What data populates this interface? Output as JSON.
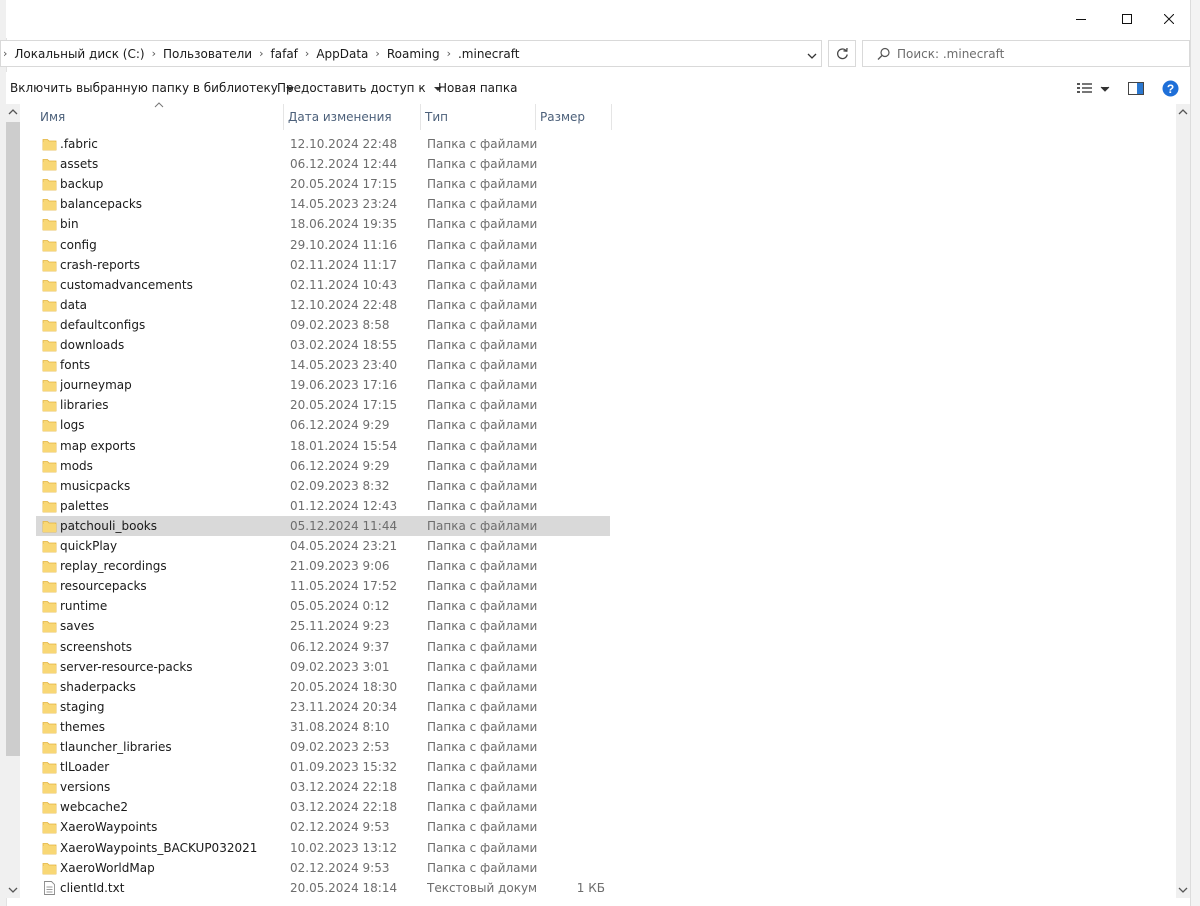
{
  "window": {
    "minimize_icon": "minimize-icon",
    "maximize_icon": "maximize-icon",
    "close_icon": "close-icon"
  },
  "address": {
    "crumbs": [
      "Локальный диск (C:)",
      "Пользователи",
      "fafaf",
      "AppData",
      "Roaming",
      ".minecraft"
    ]
  },
  "search": {
    "placeholder": "Поиск: .minecraft"
  },
  "toolbar": {
    "include_library": "Включить выбранную папку в библиотеку",
    "share": "Предоставить доступ к",
    "new_folder": "Новая папка"
  },
  "columns": {
    "name": "Имя",
    "date": "Дата изменения",
    "type": "Тип",
    "size": "Размер"
  },
  "files": [
    {
      "name": ".fabric",
      "date": "12.10.2024 22:48",
      "type": "Папка с файлами",
      "size": "",
      "kind": "folder"
    },
    {
      "name": "assets",
      "date": "06.12.2024 12:44",
      "type": "Папка с файлами",
      "size": "",
      "kind": "folder"
    },
    {
      "name": "backup",
      "date": "20.05.2024 17:15",
      "type": "Папка с файлами",
      "size": "",
      "kind": "folder"
    },
    {
      "name": "balancepacks",
      "date": "14.05.2023 23:24",
      "type": "Папка с файлами",
      "size": "",
      "kind": "folder"
    },
    {
      "name": "bin",
      "date": "18.06.2024 19:35",
      "type": "Папка с файлами",
      "size": "",
      "kind": "folder"
    },
    {
      "name": "config",
      "date": "29.10.2024 11:16",
      "type": "Папка с файлами",
      "size": "",
      "kind": "folder"
    },
    {
      "name": "crash-reports",
      "date": "02.11.2024 11:17",
      "type": "Папка с файлами",
      "size": "",
      "kind": "folder"
    },
    {
      "name": "customadvancements",
      "date": "02.11.2024 10:43",
      "type": "Папка с файлами",
      "size": "",
      "kind": "folder"
    },
    {
      "name": "data",
      "date": "12.10.2024 22:48",
      "type": "Папка с файлами",
      "size": "",
      "kind": "folder"
    },
    {
      "name": "defaultconfigs",
      "date": "09.02.2023 8:58",
      "type": "Папка с файлами",
      "size": "",
      "kind": "folder"
    },
    {
      "name": "downloads",
      "date": "03.02.2024 18:55",
      "type": "Папка с файлами",
      "size": "",
      "kind": "folder"
    },
    {
      "name": "fonts",
      "date": "14.05.2023 23:40",
      "type": "Папка с файлами",
      "size": "",
      "kind": "folder"
    },
    {
      "name": "journeymap",
      "date": "19.06.2023 17:16",
      "type": "Папка с файлами",
      "size": "",
      "kind": "folder"
    },
    {
      "name": "libraries",
      "date": "20.05.2024 17:15",
      "type": "Папка с файлами",
      "size": "",
      "kind": "folder"
    },
    {
      "name": "logs",
      "date": "06.12.2024 9:29",
      "type": "Папка с файлами",
      "size": "",
      "kind": "folder"
    },
    {
      "name": "map exports",
      "date": "18.01.2024 15:54",
      "type": "Папка с файлами",
      "size": "",
      "kind": "folder"
    },
    {
      "name": "mods",
      "date": "06.12.2024 9:29",
      "type": "Папка с файлами",
      "size": "",
      "kind": "folder"
    },
    {
      "name": "musicpacks",
      "date": "02.09.2023 8:32",
      "type": "Папка с файлами",
      "size": "",
      "kind": "folder"
    },
    {
      "name": "palettes",
      "date": "01.12.2024 12:43",
      "type": "Папка с файлами",
      "size": "",
      "kind": "folder"
    },
    {
      "name": "patchouli_books",
      "date": "05.12.2024 11:44",
      "type": "Папка с файлами",
      "size": "",
      "kind": "folder",
      "selected": true
    },
    {
      "name": "quickPlay",
      "date": "04.05.2024 23:21",
      "type": "Папка с файлами",
      "size": "",
      "kind": "folder"
    },
    {
      "name": "replay_recordings",
      "date": "21.09.2023 9:06",
      "type": "Папка с файлами",
      "size": "",
      "kind": "folder"
    },
    {
      "name": "resourcepacks",
      "date": "11.05.2024 17:52",
      "type": "Папка с файлами",
      "size": "",
      "kind": "folder"
    },
    {
      "name": "runtime",
      "date": "05.05.2024 0:12",
      "type": "Папка с файлами",
      "size": "",
      "kind": "folder"
    },
    {
      "name": "saves",
      "date": "25.11.2024 9:23",
      "type": "Папка с файлами",
      "size": "",
      "kind": "folder"
    },
    {
      "name": "screenshots",
      "date": "06.12.2024 9:37",
      "type": "Папка с файлами",
      "size": "",
      "kind": "folder"
    },
    {
      "name": "server-resource-packs",
      "date": "09.02.2023 3:01",
      "type": "Папка с файлами",
      "size": "",
      "kind": "folder"
    },
    {
      "name": "shaderpacks",
      "date": "20.05.2024 18:30",
      "type": "Папка с файлами",
      "size": "",
      "kind": "folder"
    },
    {
      "name": "staging",
      "date": "23.11.2024 20:34",
      "type": "Папка с файлами",
      "size": "",
      "kind": "folder"
    },
    {
      "name": "themes",
      "date": "31.08.2024 8:10",
      "type": "Папка с файлами",
      "size": "",
      "kind": "folder"
    },
    {
      "name": "tlauncher_libraries",
      "date": "09.02.2023 2:53",
      "type": "Папка с файлами",
      "size": "",
      "kind": "folder"
    },
    {
      "name": "tlLoader",
      "date": "01.09.2023 15:32",
      "type": "Папка с файлами",
      "size": "",
      "kind": "folder"
    },
    {
      "name": "versions",
      "date": "03.12.2024 22:18",
      "type": "Папка с файлами",
      "size": "",
      "kind": "folder"
    },
    {
      "name": "webcache2",
      "date": "03.12.2024 22:18",
      "type": "Папка с файлами",
      "size": "",
      "kind": "folder"
    },
    {
      "name": "XaeroWaypoints",
      "date": "02.12.2024 9:53",
      "type": "Папка с файлами",
      "size": "",
      "kind": "folder"
    },
    {
      "name": "XaeroWaypoints_BACKUP032021",
      "date": "10.02.2023 13:12",
      "type": "Папка с файлами",
      "size": "",
      "kind": "folder"
    },
    {
      "name": "XaeroWorldMap",
      "date": "02.12.2024 9:53",
      "type": "Папка с файлами",
      "size": "",
      "kind": "folder"
    },
    {
      "name": "clientId.txt",
      "date": "20.05.2024 18:14",
      "type": "Текстовый докум...",
      "size": "1 КБ",
      "kind": "file"
    }
  ],
  "colors": {
    "folder": "#f8d775",
    "folder_edge": "#e2b23c",
    "selected": "#d9d9d9",
    "help": "#1e6fd8"
  }
}
